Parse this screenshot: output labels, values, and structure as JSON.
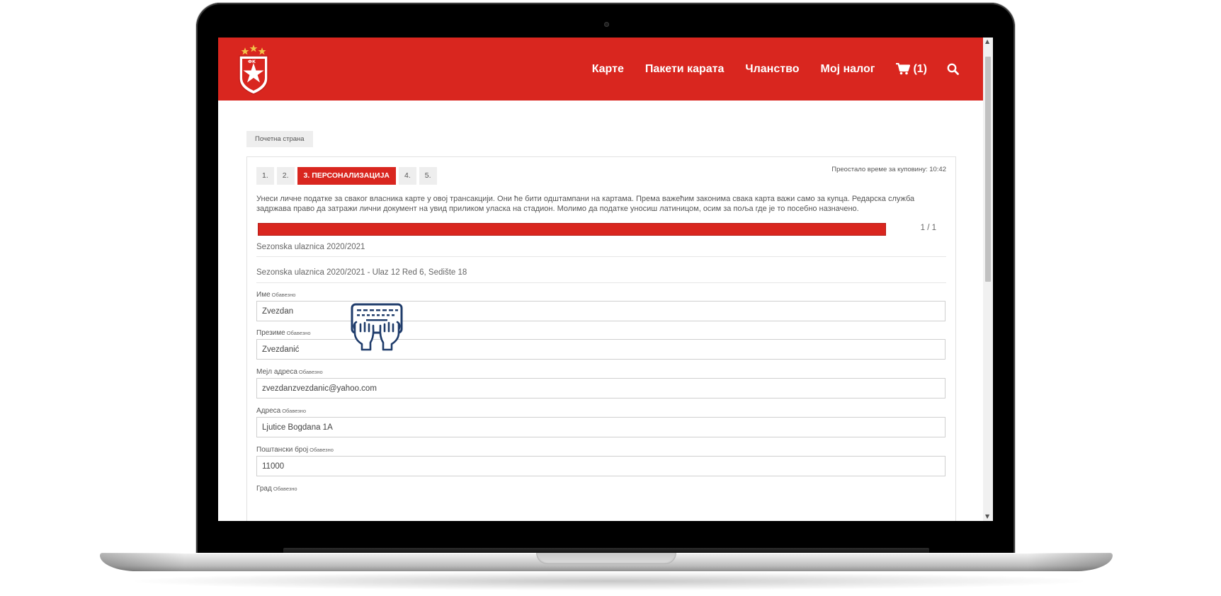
{
  "header": {
    "nav": [
      "Карте",
      "Пакети карата",
      "Чланство",
      "Мој налог"
    ],
    "cart_label": "(1)",
    "colors": {
      "brand_red": "#d9261f"
    },
    "icons": {
      "cart": "cart-icon",
      "search": "search-icon",
      "logo": "club-crest-logo"
    }
  },
  "breadcrumb": {
    "home": "Почетна страна"
  },
  "checkout": {
    "timer": "Преостало време за куповину: 10:42",
    "steps": [
      "1.",
      "2.",
      "3. ПЕРСОНАЛИЗАЦИЈА",
      "4.",
      "5."
    ],
    "active_step": 3,
    "intro": "Унеси личне податке за сваког власника карте у овој трансакцији. Они ће бити одштампани на картама. Према важећим законима свака карта важи само за купца. Редарска служба задржава право да затражи лични документ на увид приликом уласка на стадион. Молимо да податке уносиш латиницом, осим за поља где је то посебно назначено.",
    "progress": {
      "count": "1 / 1",
      "fraction": 1.0
    },
    "section_title": "Sezonska ulaznica 2020/2021",
    "ticket_title": "Sezonska ulaznica 2020/2021 - Ulaz 12 Red 6, Sedište 18",
    "required_label": "Обавезно",
    "fields": [
      {
        "label": "Име",
        "value": "Zvezdan"
      },
      {
        "label": "Презиме",
        "value": "Zvezdanić"
      },
      {
        "label": "Мејл адреса",
        "value": "zvezdanzvezdanic@yahoo.com"
      },
      {
        "label": "Адреса",
        "value": "Ljutice Bogdana 1A"
      },
      {
        "label": "Поштански број",
        "value": "11000"
      },
      {
        "label": "Град",
        "value": ""
      }
    ],
    "overlay_icon": "typing-keyboard-icon"
  }
}
